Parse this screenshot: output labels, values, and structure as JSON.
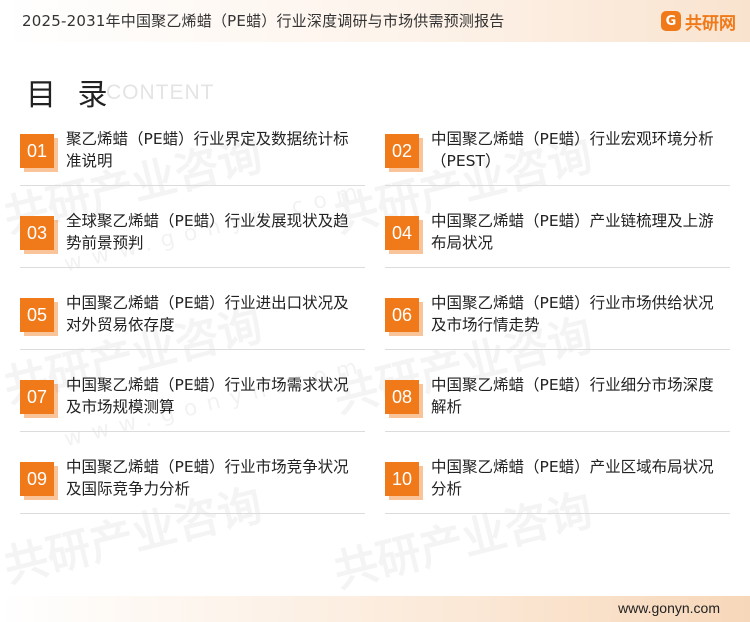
{
  "header": {
    "title": "2025-2031年中国聚乙烯蜡（PE蜡）行业深度调研与市场供需预测报告",
    "brand_icon": "G",
    "brand_name": "共研网"
  },
  "watermark": {
    "text": "共研产业咨询",
    "url": "www.gonyn.com"
  },
  "toc": {
    "heading": "目 录",
    "subheading": "CONTENT",
    "items": [
      {
        "number": "01",
        "text": "聚乙烯蜡（PE蜡）行业界定及数据统计标准说明"
      },
      {
        "number": "02",
        "text": "中国聚乙烯蜡（PE蜡）行业宏观环境分析（PEST）"
      },
      {
        "number": "03",
        "text": "全球聚乙烯蜡（PE蜡）行业发展现状及趋势前景预判"
      },
      {
        "number": "04",
        "text": "中国聚乙烯蜡（PE蜡）产业链梳理及上游布局状况"
      },
      {
        "number": "05",
        "text": "中国聚乙烯蜡（PE蜡）行业进出口状况及对外贸易依存度"
      },
      {
        "number": "06",
        "text": "中国聚乙烯蜡（PE蜡）行业市场供给状况及市场行情走势"
      },
      {
        "number": "07",
        "text": "中国聚乙烯蜡（PE蜡）行业市场需求状况及市场规模测算"
      },
      {
        "number": "08",
        "text": "中国聚乙烯蜡（PE蜡）行业细分市场深度解析"
      },
      {
        "number": "09",
        "text": "中国聚乙烯蜡（PE蜡）行业市场竞争状况及国际竞争力分析"
      },
      {
        "number": "10",
        "text": "中国聚乙烯蜡（PE蜡）产业区域布局状况分析"
      }
    ]
  },
  "footer": {
    "url": "www.gonyn.com"
  },
  "colors": {
    "accent": "#f07a1a",
    "accent_light": "#f9c49a"
  }
}
